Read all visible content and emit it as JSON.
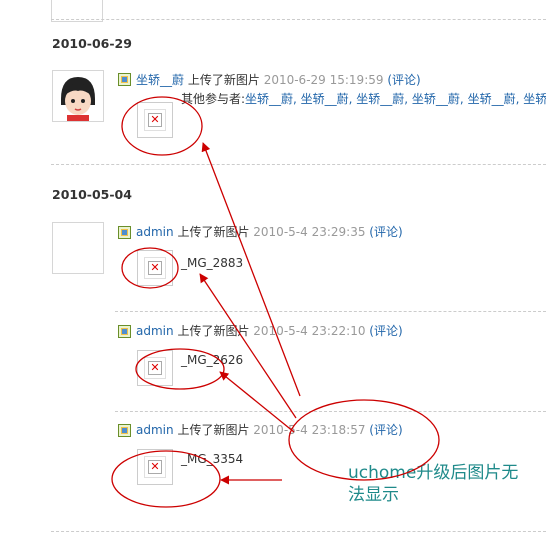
{
  "top_partial": {},
  "groups": [
    {
      "date": "2010-06-29",
      "entries": [
        {
          "user": "坐轿__蔚",
          "action": "上传了新图片",
          "time": "2010-6-29 15:19:59",
          "comment": "(评论)",
          "participants_label": "其他参与者:",
          "participants_names": "坐轿__蔚, 坐轿__蔚, 坐轿__蔚, 坐轿__蔚, 坐轿__蔚, 坐轿__蔚",
          "pic_title": ""
        }
      ]
    },
    {
      "date": "2010-05-04",
      "entries": [
        {
          "user": "admin",
          "action": "上传了新图片",
          "time": "2010-5-4 23:29:35",
          "comment": "(评论)",
          "pic_title": "_MG_2883"
        },
        {
          "user": "admin",
          "action": "上传了新图片",
          "time": "2010-5-4 23:22:10",
          "comment": "(评论)",
          "pic_title": "_MG_2626"
        },
        {
          "user": "admin",
          "action": "上传了新图片",
          "time": "2010-5-4 23:18:57",
          "comment": "(评论)",
          "pic_title": "_MG_3354"
        }
      ]
    }
  ],
  "annotation": {
    "text_line1": "uchome升级后图片无",
    "text_line2": "法显示",
    "color": "#1f8a8a",
    "mark_color": "#cc0000"
  }
}
